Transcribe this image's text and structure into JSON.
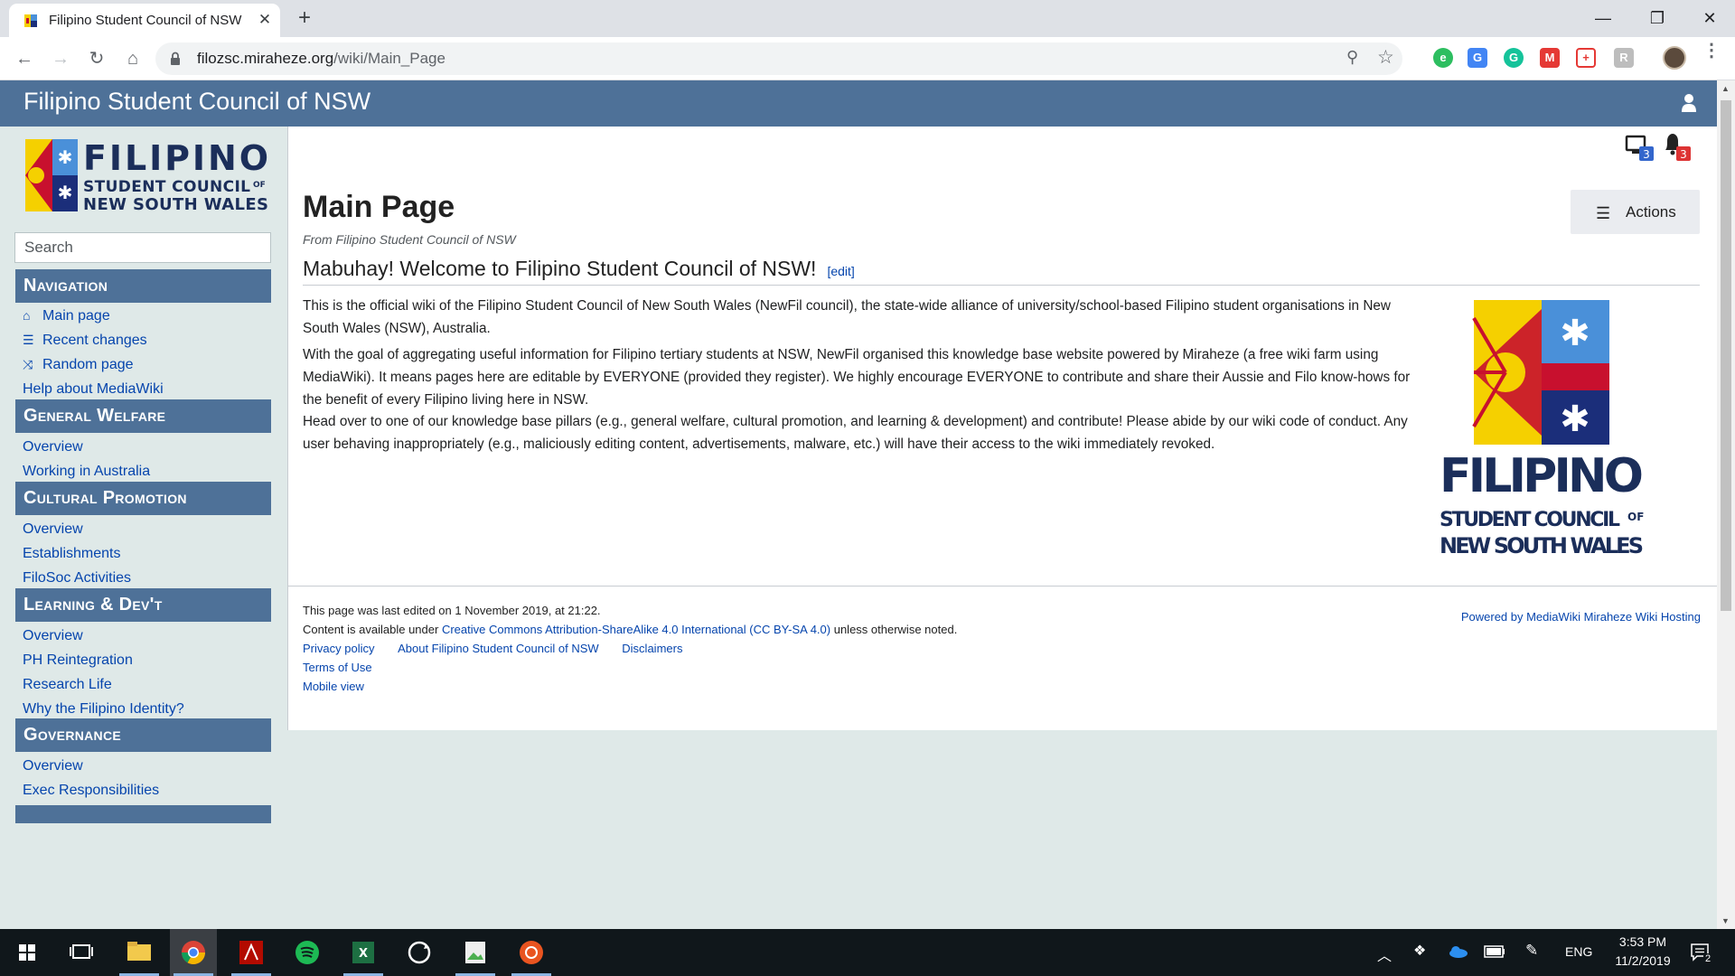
{
  "browser": {
    "tab_title": "Filipino Student Council of NSW",
    "tab_close": "✕",
    "new_tab": "+",
    "url_host": "filozsc.miraheze.org",
    "url_path": "/wiki/Main_Page",
    "window_controls": [
      "—",
      "❐",
      "✕"
    ]
  },
  "wiki": {
    "site_title": "Filipino Student Council of NSW",
    "search_placeholder": "Search",
    "notifications": {
      "alerts_count": "3",
      "notices_count": "3"
    },
    "sidebar": [
      {
        "heading": "Navigation",
        "links": [
          {
            "label": "Main page",
            "icon": "home-icon"
          },
          {
            "label": "Recent changes",
            "icon": "list-icon"
          },
          {
            "label": "Random page",
            "icon": "shuffle-icon"
          },
          {
            "label": "Help about MediaWiki",
            "icon": ""
          }
        ]
      },
      {
        "heading": "General Welfare",
        "links": [
          {
            "label": "Overview"
          },
          {
            "label": "Working in Australia"
          }
        ]
      },
      {
        "heading": "Cultural Promotion",
        "links": [
          {
            "label": "Overview"
          },
          {
            "label": "Establishments"
          },
          {
            "label": "FiloSoc Activities"
          }
        ]
      },
      {
        "heading": "Learning & Dev't",
        "links": [
          {
            "label": "Overview"
          },
          {
            "label": "PH Reintegration"
          },
          {
            "label": "Research Life"
          },
          {
            "label": "Why the Filipino Identity?"
          }
        ]
      },
      {
        "heading": "Governance",
        "links": [
          {
            "label": "Overview"
          },
          {
            "label": "Exec Responsibilities"
          }
        ]
      }
    ],
    "page": {
      "title": "Main Page",
      "actions_label": "Actions",
      "tagline": "From Filipino Student Council of NSW",
      "section_title": "Mabuhay! Welcome to Filipino Student Council of NSW!",
      "edit_label": "[edit]",
      "paragraphs": [
        "This is the official wiki of the Filipino Student Council of New South Wales (NewFil council), the state-wide alliance of university/school-based Filipino student organisations in New South Wales (NSW), Australia.",
        "With the goal of aggregating useful information for Filipino tertiary students at NSW, NewFil organised this knowledge base website powered by Miraheze (a free wiki farm using MediaWiki). It means pages here are editable by EVERYONE (provided they register). We highly encourage EVERYONE to contribute and share their Aussie and Filo know-hows for the benefit of every Filipino living here in NSW.",
        "Head over to one of our knowledge base pillars (e.g., general welfare, cultural promotion, and learning & development) and contribute! Please abide by our wiki code of conduct. Any user behaving inappropriately (e.g., maliciously editing content, advertisements, malware, etc.) will have their access to the wiki immediately revoked."
      ]
    },
    "logo_text": {
      "line1": "FILIPINO",
      "line2": "STUDENT COUNCIL",
      "of": "OF",
      "line3": "NEW SOUTH WALES"
    },
    "footer": {
      "last_edited": "This page was last edited on 1 November 2019, at 21:22.",
      "license_prefix": "Content is available under ",
      "license_link": "Creative Commons Attribution-ShareAlike 4.0 International (CC BY-SA 4.0)",
      "license_suffix": " unless otherwise noted.",
      "links_row1": [
        "Privacy policy",
        "About Filipino Student Council of NSW",
        "Disclaimers"
      ],
      "link_terms": "Terms of Use",
      "link_mobile": "Mobile view",
      "powered_by": "Powered by MediaWiki Miraheze Wiki Hosting"
    }
  },
  "taskbar": {
    "language": "ENG",
    "time": "3:53 PM",
    "date": "11/2/2019",
    "notification_count": "2"
  },
  "colors": {
    "wiki_header": "#4e7198",
    "sidebar_bg": "#dfe9e8",
    "link": "#0645ad",
    "taskbar": "#10171b"
  }
}
